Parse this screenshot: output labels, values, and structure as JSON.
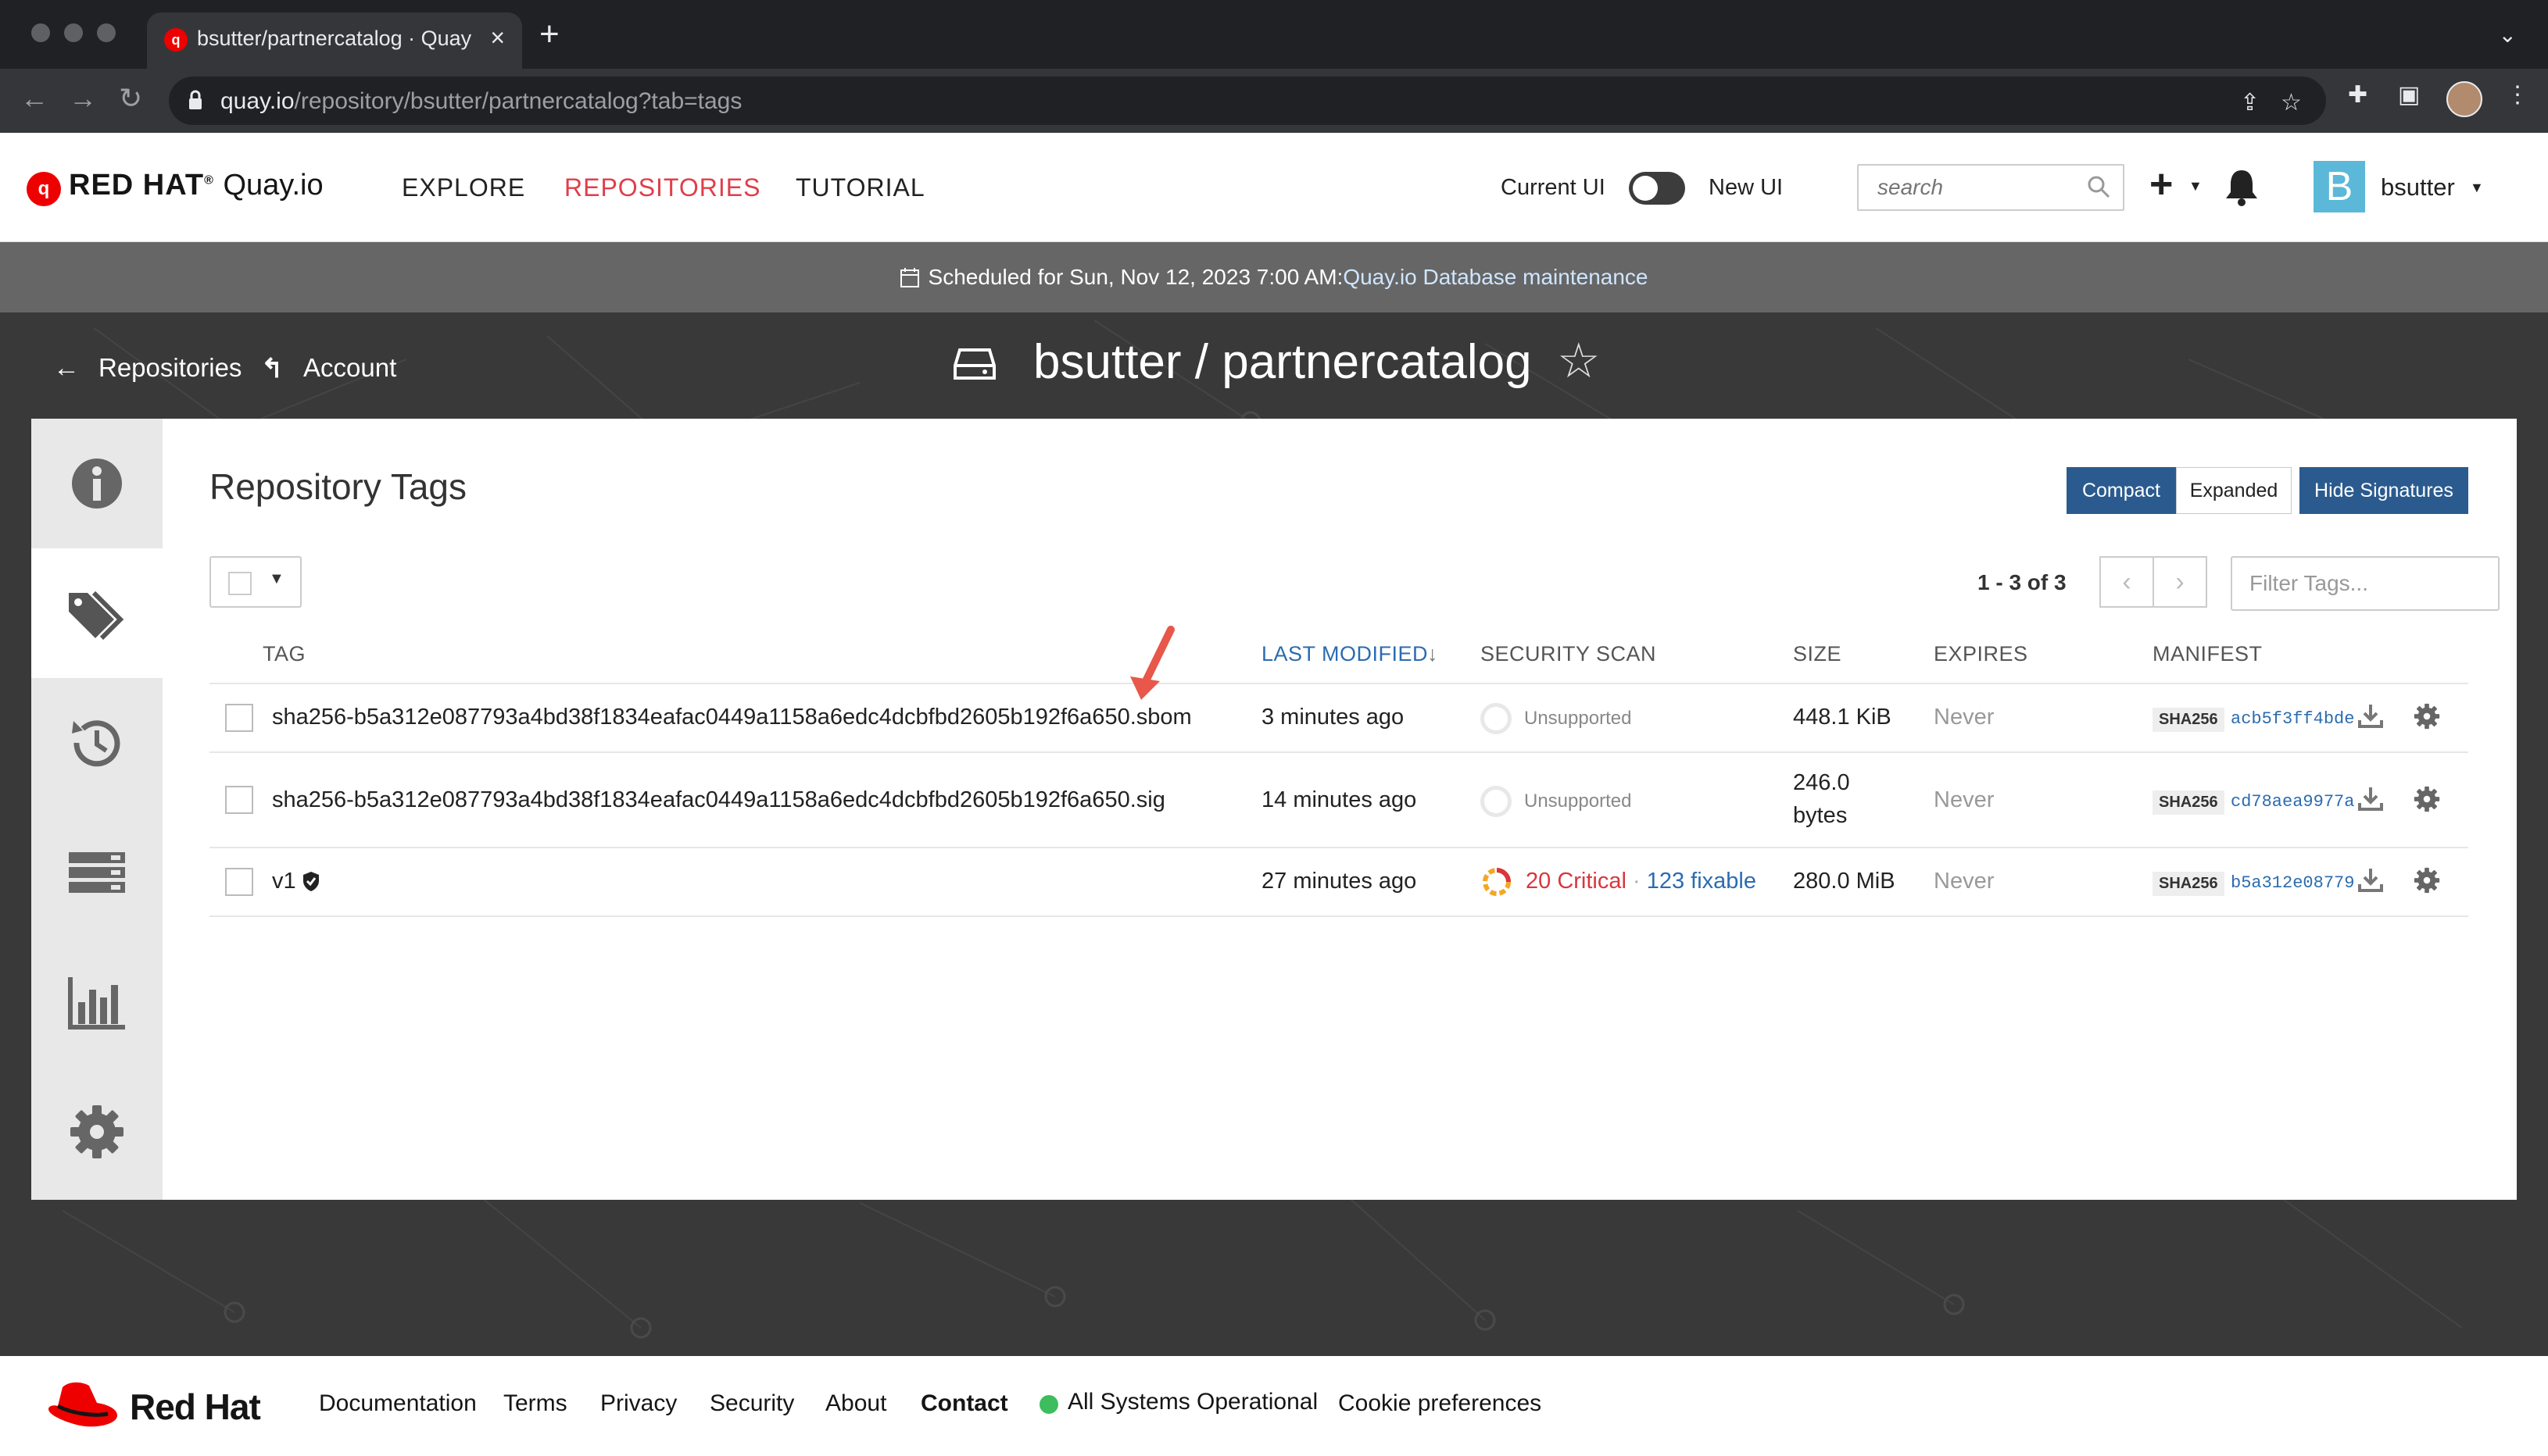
{
  "browser": {
    "tab_title": "bsutter/partnercatalog · Quay",
    "url_host": "quay.io",
    "url_path": "/repository/bsutter/partnercatalog?tab=tags"
  },
  "header": {
    "logo_brand": "RED HAT",
    "logo_product": "Quay.io",
    "nav": [
      "EXPLORE",
      "REPOSITORIES",
      "TUTORIAL"
    ],
    "active_nav": "REPOSITORIES",
    "ui_toggle_left": "Current UI",
    "ui_toggle_right": "New UI",
    "search_placeholder": "search",
    "avatar_letter": "B",
    "username": "bsutter"
  },
  "banner": {
    "text": "Scheduled for Sun, Nov 12, 2023 7:00 AM:",
    "link": "Quay.io Database maintenance"
  },
  "repo": {
    "breadcrumb_repositories": "Repositories",
    "breadcrumb_account": "Account",
    "title": "bsutter / partnercatalog"
  },
  "tags_page": {
    "heading": "Repository Tags",
    "view_buttons": {
      "compact": "Compact",
      "expanded": "Expanded",
      "hide_signatures": "Hide Signatures"
    },
    "pagination": "1 - 3 of 3",
    "filter_placeholder": "Filter Tags...",
    "columns": [
      "TAG",
      "LAST MODIFIED",
      "SECURITY SCAN",
      "SIZE",
      "EXPIRES",
      "MANIFEST"
    ],
    "sort_indicator": "↓",
    "rows": [
      {
        "tag": "sha256-b5a312e087793a4bd38f1834eafac0449a1158a6edc4dcbfbd2605b192f6a650.sbom",
        "last_modified": "3 minutes ago",
        "scan": "Unsupported",
        "size_line1": "448.1 KiB",
        "size_line2": "",
        "expires": "Never",
        "manifest_algo": "SHA256",
        "manifest_digest": "acb5f3ff4bde"
      },
      {
        "tag": "sha256-b5a312e087793a4bd38f1834eafac0449a1158a6edc4dcbfbd2605b192f6a650.sig",
        "last_modified": "14 minutes ago",
        "scan": "Unsupported",
        "size_line1": "246.0",
        "size_line2": "bytes",
        "expires": "Never",
        "manifest_algo": "SHA256",
        "manifest_digest": "cd78aea9977a"
      },
      {
        "tag": "v1",
        "last_modified": "27 minutes ago",
        "scan_critical": "20 Critical",
        "scan_sep": "·",
        "scan_fixable": "123 fixable",
        "size_line1": "280.0 MiB",
        "size_line2": "",
        "expires": "Never",
        "manifest_algo": "SHA256",
        "manifest_digest": "b5a312e08779"
      }
    ]
  },
  "footer": {
    "brand": "Red Hat",
    "links": [
      "Documentation",
      "Terms",
      "Privacy",
      "Security",
      "About",
      "Contact"
    ],
    "status": "All Systems Operational",
    "cookie": "Cookie preferences"
  },
  "colors": {
    "accent_red": "#e03e4a",
    "primary_blue": "#2b5b8e",
    "critical_red": "#d9363e",
    "link_blue": "#2b6cb0",
    "status_green": "#3dbd5d"
  }
}
